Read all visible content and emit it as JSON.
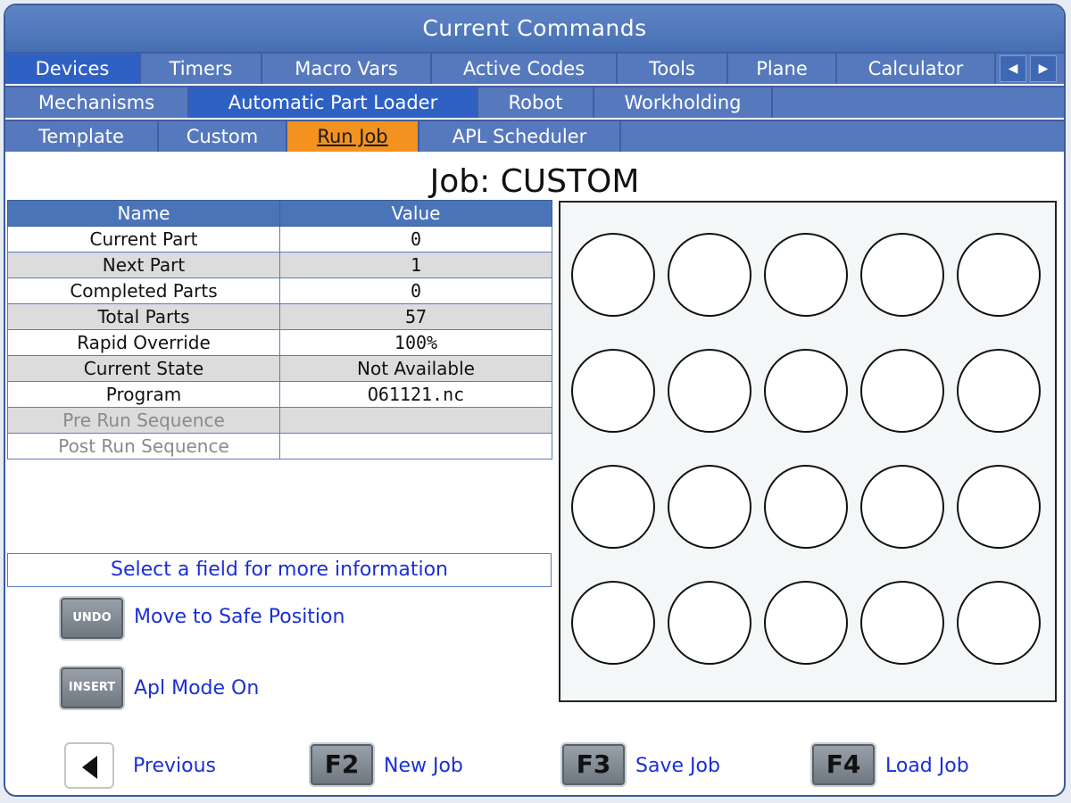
{
  "window": {
    "title": "Current Commands"
  },
  "tabs": {
    "row1": [
      "Devices",
      "Timers",
      "Macro Vars",
      "Active Codes",
      "Tools",
      "Plane",
      "Calculator"
    ],
    "row2": [
      "Mechanisms",
      "Automatic Part Loader",
      "Robot",
      "Workholding"
    ],
    "row3": [
      "Template",
      "Custom",
      "Run Job",
      "APL Scheduler"
    ],
    "scroll_left": "◀",
    "scroll_right": "▶"
  },
  "job": {
    "title": "Job: CUSTOM"
  },
  "table": {
    "headers": [
      "Name",
      "Value"
    ],
    "rows": [
      {
        "name": "Current Part",
        "value": "0"
      },
      {
        "name": "Next Part",
        "value": "1"
      },
      {
        "name": "Completed Parts",
        "value": "0"
      },
      {
        "name": "Total Parts",
        "value": "57"
      },
      {
        "name": "Rapid Override",
        "value": "100%"
      },
      {
        "name": "Current State",
        "value": "Not Available"
      },
      {
        "name": "Program",
        "value": "O61121.nc"
      },
      {
        "name": "Pre Run Sequence",
        "value": ""
      },
      {
        "name": "Post Run Sequence",
        "value": ""
      }
    ]
  },
  "info": {
    "message": "Select a field for more information"
  },
  "actions": [
    {
      "key": "UNDO",
      "label": "Move to Safe Position"
    },
    {
      "key": "INSERT",
      "label": "Apl Mode On"
    }
  ],
  "grid": {
    "rows": 4,
    "cols": 5
  },
  "footer": {
    "previous_label": "Previous",
    "keys": [
      {
        "key": "F2",
        "label": "New Job"
      },
      {
        "key": "F3",
        "label": "Save Job"
      },
      {
        "key": "F4",
        "label": "Load Job"
      }
    ]
  },
  "colors": {
    "tab_bar": "#5679bd",
    "tab_active_blue": "#2f61c4",
    "tab_active_orange": "#f3921f",
    "link_text": "#1a2fd6"
  }
}
